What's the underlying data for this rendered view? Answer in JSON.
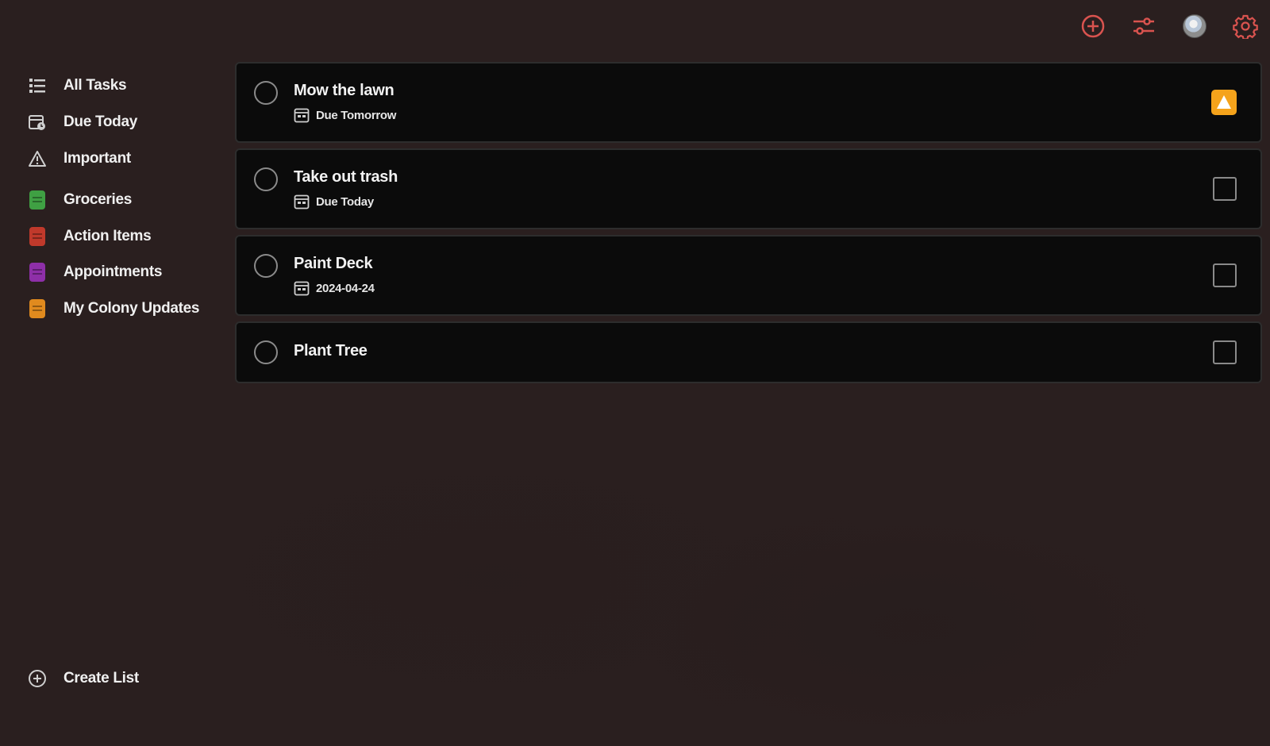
{
  "colors": {
    "background": "#2a1f1f",
    "accent_red": "#d9534f",
    "card_bg": "#0b0b0b",
    "important_badge": "#f5a31b"
  },
  "toolbar": {
    "add_icon": "add-circle-icon",
    "filter_icon": "sliders-icon",
    "avatar_icon": "avatar",
    "settings_icon": "gear-icon"
  },
  "sidebar": {
    "filters": [
      {
        "label": "All Tasks",
        "icon": "list-icon"
      },
      {
        "label": "Due Today",
        "icon": "calendar-clock-icon"
      },
      {
        "label": "Important",
        "icon": "warning-icon"
      }
    ],
    "lists": [
      {
        "label": "Groceries",
        "color": "#3fa043"
      },
      {
        "label": "Action Items",
        "color": "#c0392b"
      },
      {
        "label": "Appointments",
        "color": "#8e2fa8"
      },
      {
        "label": "My Colony Updates",
        "color": "#e08a1e"
      }
    ],
    "create_list_label": "Create List"
  },
  "tasks": [
    {
      "title": "Mow the lawn",
      "due": "Due Tomorrow",
      "important": true
    },
    {
      "title": "Take out trash",
      "due": "Due Today",
      "important": false
    },
    {
      "title": "Paint Deck",
      "due": "2024-04-24",
      "important": false
    },
    {
      "title": "Plant Tree",
      "due": "",
      "important": false
    }
  ]
}
